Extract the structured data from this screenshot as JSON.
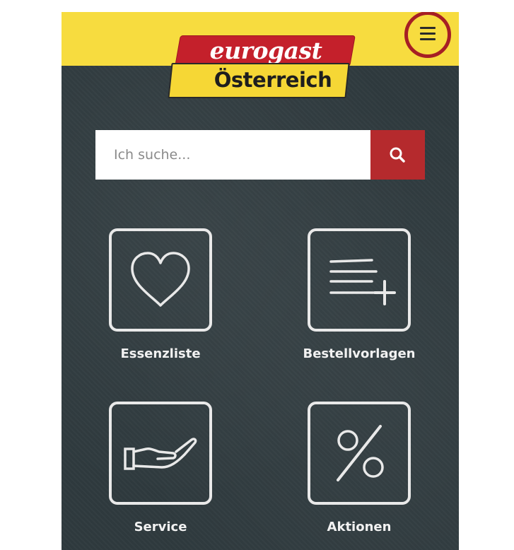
{
  "brand": {
    "name": "eurogast",
    "subtitle": "Österreich"
  },
  "header": {
    "menu_icon": "hamburger-menu-icon"
  },
  "search": {
    "placeholder": "Ich suche...",
    "value": "",
    "icon": "search-icon"
  },
  "tiles": [
    {
      "label": "Essenzliste",
      "icon": "heart-icon"
    },
    {
      "label": "Bestellvorlagen",
      "icon": "list-add-icon"
    },
    {
      "label": "Service",
      "icon": "hand-icon"
    },
    {
      "label": "Aktionen",
      "icon": "percent-icon"
    }
  ],
  "colors": {
    "header_yellow": "#f7dc3f",
    "brand_red": "#c4202b",
    "search_button": "#b52a2d",
    "chalkboard": "#2f3a3e",
    "menu_ring": "#a61f24"
  }
}
